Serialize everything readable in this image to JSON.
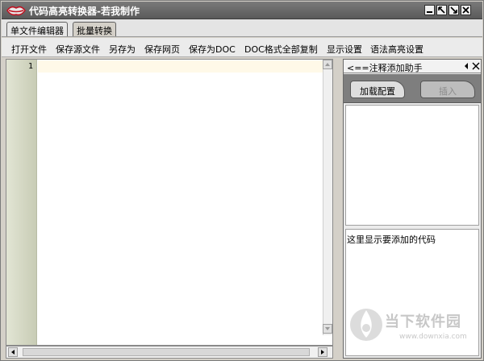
{
  "window": {
    "title": "代码高亮转换器-若我制作",
    "controls": [
      "minimize",
      "restore",
      "maximize",
      "close"
    ]
  },
  "tabs": [
    {
      "label": "单文件编辑器",
      "active": true
    },
    {
      "label": "批量转换",
      "active": false
    }
  ],
  "menu": {
    "items": [
      "打开文件",
      "保存源文件",
      "另存为",
      "保存网页",
      "保存为DOC",
      "DOC格式全部复制",
      "显示设置",
      "语法高亮设置"
    ]
  },
  "editor": {
    "line_numbers": [
      "1"
    ],
    "current_line_color": "#fff9e8"
  },
  "panel": {
    "title": "<==注释添加助手",
    "load_config_label": "加载配置",
    "insert_label": "插入",
    "code_preview_text": "这里显示要添加的代码"
  },
  "watermark": {
    "logo_icon": "downxia-logo-icon",
    "name": "当下软件园",
    "url": "www.downxia.com"
  },
  "colors": {
    "titlebar": "#6a6a6a",
    "window_bg": "#d4d0c8",
    "panel_toolbar": "#7e7e7e",
    "gutter": "#d4d8c2"
  }
}
